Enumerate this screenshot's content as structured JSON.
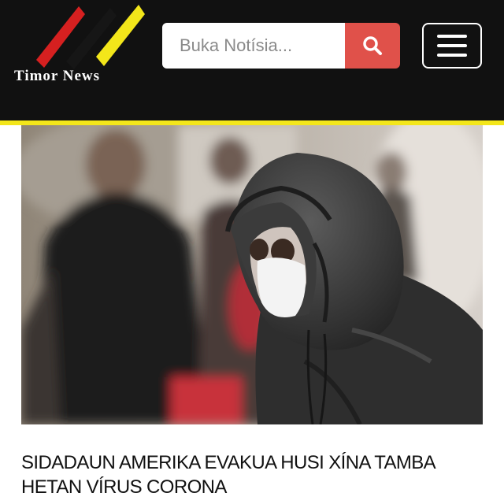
{
  "site": {
    "name": "Timor News",
    "logo_stripes": [
      "#d62020",
      "#111111",
      "#f3e61a"
    ]
  },
  "header": {
    "background": "#111111",
    "accent": "#f3e61a"
  },
  "search": {
    "placeholder": "Buka Notísia...",
    "button_color": "#e0514a",
    "icon": "search-icon"
  },
  "menu": {
    "icon": "hamburger-menu-icon"
  },
  "article": {
    "headline": "SIDADAUN AMERIKA EVAKUA HUSI XÍNA TAMBA HETAN VÍRUS CORONA"
  }
}
